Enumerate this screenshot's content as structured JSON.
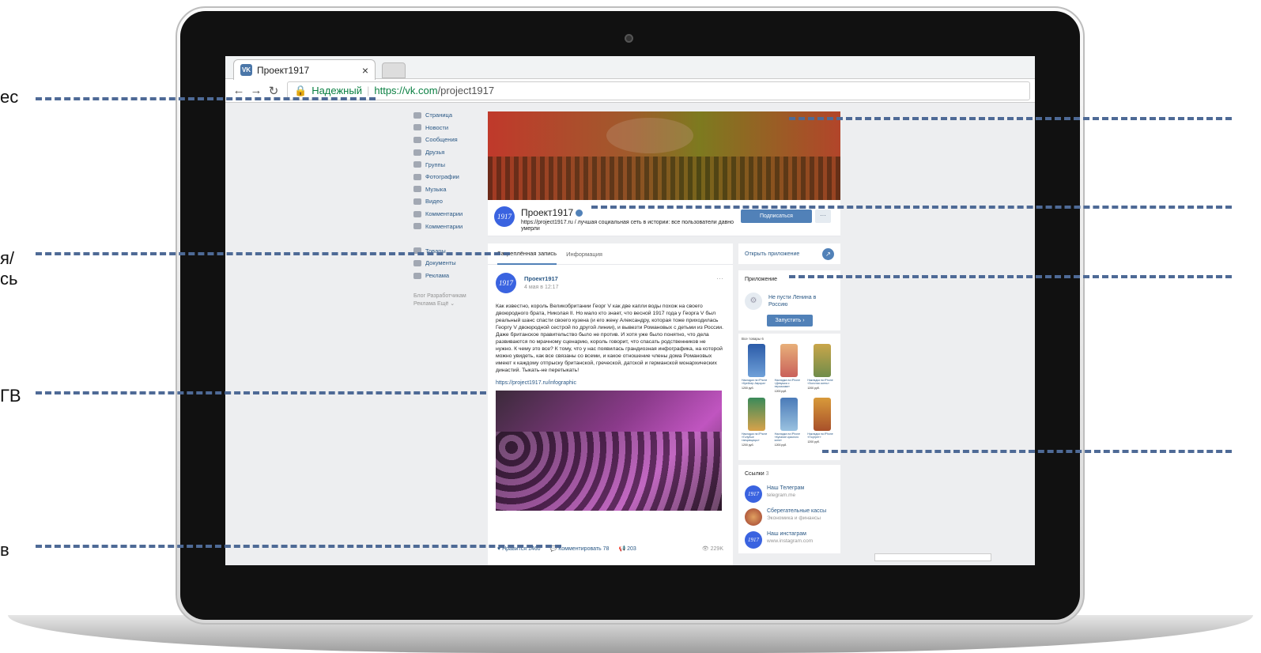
{
  "side_labels": [
    "ес",
    "я/",
    "сь",
    "ГВ",
    "в"
  ],
  "browser": {
    "tab_title": "Проект1917",
    "tab_favicon": "VK",
    "tab_close": "×",
    "security_label": "Надежный",
    "url_scheme_host": "https://vk.com",
    "url_path": "/project1917"
  },
  "left_nav": {
    "items": [
      "Страница",
      "Новости",
      "Сообщения",
      "Друзья",
      "Группы",
      "Фотографии",
      "Музыка",
      "Видео",
      "Комментарии",
      "Комментарии",
      "",
      "Товары",
      "Документы",
      "Реклама"
    ],
    "footer_line1": "Блог   Разработчикам",
    "footer_line2": "Реклама   Ещё ⌄"
  },
  "group": {
    "avatar_text": "1917",
    "name": "Проект1917",
    "status": "https://project1917.ru / лучшая социальная сеть в истории: все пользователи давно умерли",
    "subscribe_label": "Подписаться",
    "more_label": "···"
  },
  "feed": {
    "tabs": [
      "Закреплённая запись",
      "Информация"
    ],
    "post": {
      "author": "Проект1917",
      "date": "4 мая в 12:17",
      "more": "···",
      "text": "Как известно, король Великобритании Георг V как две капли воды похож на своего двоюродного брата, Николая II. Но мало кто знает, что весной 1917 года у Георга V был реальный шанс спасти своего кузена (и его жену Александру, которая тоже приходилась Георгу V двоюродной сестрой по другой линии), и вывезти Романовых с детьми из России. Даже британское правительство было не против. И хотя уже было понятно, что дела развиваются по мрачному сценарию, король говорит, что спасать родственников не нужно. К чему это все? К тому, что у нас появилась грандиозная инфографика, на которой можно увидеть, как все связаны со всеми, и какое отношение члены дома Романовых имеют к каждому отпрыску британской, греческой, датской и германской монархических династий. Тыкать-не перетыкать!",
      "link": "https://project1917.ru/infographic",
      "like_label": "Нравится",
      "like_count": "1460",
      "comment_label": "Комментировать",
      "comment_count": "78",
      "share_count": "203",
      "views": "229K"
    }
  },
  "right": {
    "open_app": "Открыть приложение",
    "open_app_icon": "↗",
    "app_block_title": "Приложение",
    "app_name": "Не пусти Ленина в Россию",
    "run_label": "Запустить ›",
    "goods_title": "Все товары 6",
    "goods": [
      {
        "caption": "Накладка на iPhone «Крейсер Аврора»",
        "price": "1200 руб."
      },
      {
        "caption": "Накладка на iPhone «Девушка с персиками»",
        "price": "1200 руб."
      },
      {
        "caption": "Накладка на iPhone «Золотая осень»",
        "price": "1200 руб."
      },
      {
        "caption": "Накладка на iPhone «Голубые танцовщицы»",
        "price": "1200 руб."
      },
      {
        "caption": "Накладка на iPhone «Купание красного коня»",
        "price": "1200 руб."
      },
      {
        "caption": "Накладка на iPhone «Портрет»",
        "price": "1200 руб."
      }
    ],
    "links_title": "Ссылки",
    "links_count": "3",
    "links": [
      {
        "name": "Наш Телеграм",
        "sub": "telegram.me",
        "avatar": "1917"
      },
      {
        "name": "Сберегательные кассы",
        "sub": "Экономика и финансы",
        "avatar": ""
      },
      {
        "name": "Наш инстаграм",
        "sub": "www.instagram.com",
        "avatar": "1917"
      }
    ]
  },
  "colors": {
    "accent": "#5181b8",
    "link": "#2a5885",
    "guide": "#4e6a96"
  }
}
